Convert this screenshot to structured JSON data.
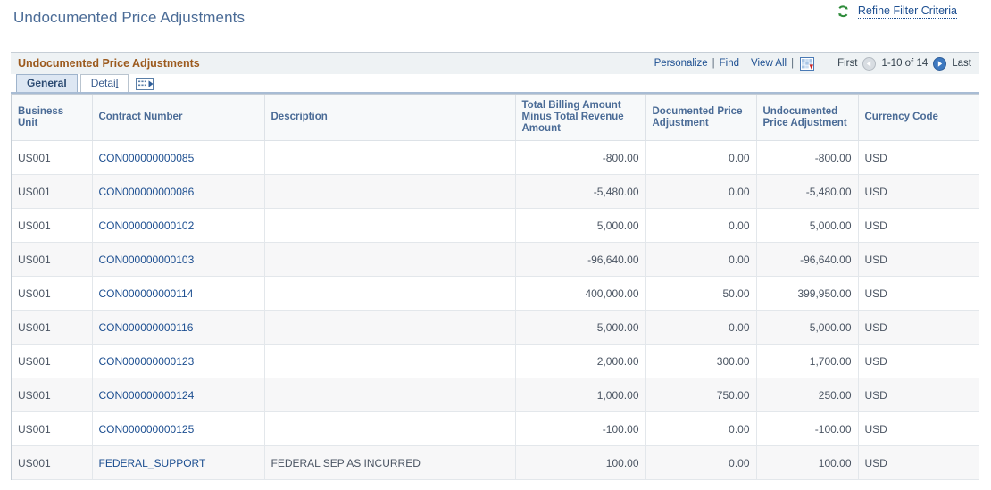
{
  "page": {
    "title": "Undocumented Price Adjustments",
    "refine_link": "Refine Filter Criteria",
    "refresh_icon": "refresh-icon",
    "accent_title_color": "#4a6b96",
    "group_title_color": "#9c5a1e",
    "link_color": "#1d4f91"
  },
  "groupbox": {
    "title": "Undocumented Price Adjustments",
    "actions": {
      "personalize": "Personalize",
      "find": "Find",
      "view_all": "View All",
      "download_icon": "spreadsheet-download-icon",
      "sep": "|"
    },
    "nav": {
      "first": "First",
      "prev_icon": "previous-page-arrow-icon",
      "counter": "1-10 of 14",
      "next_icon": "next-page-arrow-icon",
      "last": "Last"
    },
    "tabs": [
      {
        "label": "General",
        "active": true,
        "accesskey": ""
      },
      {
        "label": "Detai",
        "active": false,
        "accesskey": "l"
      }
    ],
    "tab_expand_icon": "expand-row-icon"
  },
  "table": {
    "columns": [
      "Business Unit",
      "Contract Number",
      "Description",
      "Total Billing Amount Minus Total Revenue Amount",
      "Documented Price Adjustment",
      "Undocumented Price Adjustment",
      "Currency Code"
    ],
    "rows": [
      {
        "business_unit": "US001",
        "contract_number": "CON000000000085",
        "description": "",
        "total_billing_minus_revenue": "-800.00",
        "documented_price_adjustment": "0.00",
        "undocumented_price_adjustment": "-800.00",
        "currency_code": "USD"
      },
      {
        "business_unit": "US001",
        "contract_number": "CON000000000086",
        "description": "",
        "total_billing_minus_revenue": "-5,480.00",
        "documented_price_adjustment": "0.00",
        "undocumented_price_adjustment": "-5,480.00",
        "currency_code": "USD"
      },
      {
        "business_unit": "US001",
        "contract_number": "CON000000000102",
        "description": "",
        "total_billing_minus_revenue": "5,000.00",
        "documented_price_adjustment": "0.00",
        "undocumented_price_adjustment": "5,000.00",
        "currency_code": "USD"
      },
      {
        "business_unit": "US001",
        "contract_number": "CON000000000103",
        "description": "",
        "total_billing_minus_revenue": "-96,640.00",
        "documented_price_adjustment": "0.00",
        "undocumented_price_adjustment": "-96,640.00",
        "currency_code": "USD"
      },
      {
        "business_unit": "US001",
        "contract_number": "CON000000000114",
        "description": "",
        "total_billing_minus_revenue": "400,000.00",
        "documented_price_adjustment": "50.00",
        "undocumented_price_adjustment": "399,950.00",
        "currency_code": "USD"
      },
      {
        "business_unit": "US001",
        "contract_number": "CON000000000116",
        "description": "",
        "total_billing_minus_revenue": "5,000.00",
        "documented_price_adjustment": "0.00",
        "undocumented_price_adjustment": "5,000.00",
        "currency_code": "USD"
      },
      {
        "business_unit": "US001",
        "contract_number": "CON000000000123",
        "description": "",
        "total_billing_minus_revenue": "2,000.00",
        "documented_price_adjustment": "300.00",
        "undocumented_price_adjustment": "1,700.00",
        "currency_code": "USD"
      },
      {
        "business_unit": "US001",
        "contract_number": "CON000000000124",
        "description": "",
        "total_billing_minus_revenue": "1,000.00",
        "documented_price_adjustment": "750.00",
        "undocumented_price_adjustment": "250.00",
        "currency_code": "USD"
      },
      {
        "business_unit": "US001",
        "contract_number": "CON000000000125",
        "description": "",
        "total_billing_minus_revenue": "-100.00",
        "documented_price_adjustment": "0.00",
        "undocumented_price_adjustment": "-100.00",
        "currency_code": "USD"
      },
      {
        "business_unit": "US001",
        "contract_number": "FEDERAL_SUPPORT",
        "description": "FEDERAL SEP AS INCURRED",
        "total_billing_minus_revenue": "100.00",
        "documented_price_adjustment": "0.00",
        "undocumented_price_adjustment": "100.00",
        "currency_code": "USD"
      }
    ]
  }
}
